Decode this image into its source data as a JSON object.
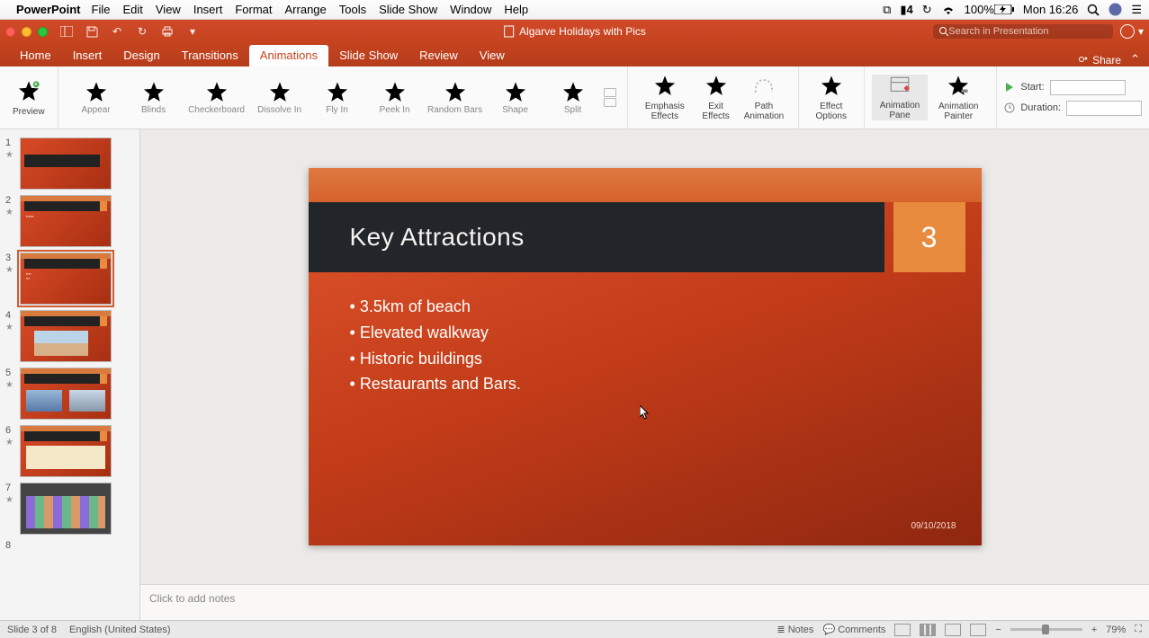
{
  "mac_menu": {
    "app": "PowerPoint",
    "items": [
      "File",
      "Edit",
      "View",
      "Insert",
      "Format",
      "Arrange",
      "Tools",
      "Slide Show",
      "Window",
      "Help"
    ],
    "right": {
      "adobe": "4",
      "battery": "100%",
      "clock": "Mon 16:26"
    }
  },
  "titlebar": {
    "doc": "Algarve Holidays with Pics",
    "search_placeholder": "Search in Presentation"
  },
  "tabs": [
    "Home",
    "Insert",
    "Design",
    "Transitions",
    "Animations",
    "Slide Show",
    "Review",
    "View"
  ],
  "active_tab": "Animations",
  "share_label": "Share",
  "ribbon": {
    "preview": "Preview",
    "entrance": [
      "Appear",
      "Blinds",
      "Checkerboard",
      "Dissolve In",
      "Fly In",
      "Peek In",
      "Random Bars",
      "Shape",
      "Split"
    ],
    "emphasis": "Emphasis Effects",
    "exit": "Exit Effects",
    "path": "Path Animation",
    "effect_options": "Effect Options",
    "anim_pane": "Animation Pane",
    "anim_painter": "Animation Painter",
    "start": "Start:",
    "duration": "Duration:"
  },
  "thumbnails": [
    1,
    2,
    3,
    4,
    5,
    6,
    7,
    8
  ],
  "selected_thumb": 3,
  "slide": {
    "title": "Key Attractions",
    "number": "3",
    "bullets": [
      "3.5km of beach",
      "Elevated walkway",
      "Historic buildings",
      "Restaurants and Bars."
    ],
    "date": "09/10/2018"
  },
  "notes_placeholder": "Click to add notes",
  "status": {
    "slide_pos": "Slide 3 of 8",
    "lang": "English (United States)",
    "notes": "Notes",
    "comments": "Comments",
    "zoom": "79%"
  }
}
